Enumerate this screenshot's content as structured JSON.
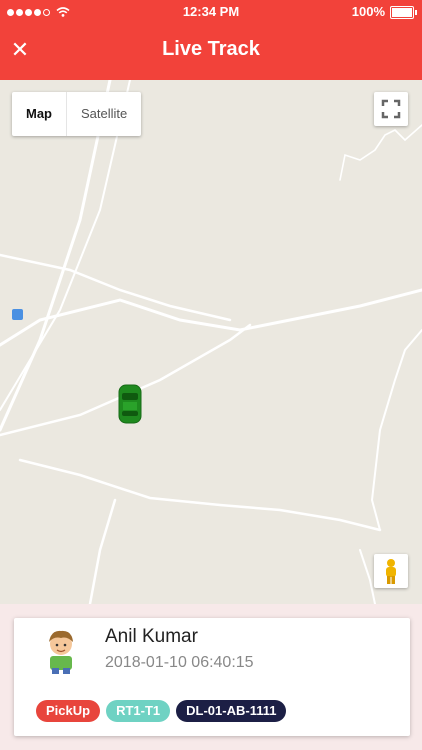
{
  "status_bar": {
    "time": "12:34 PM",
    "battery": "100%"
  },
  "header": {
    "close_icon": "close-icon",
    "title": "Live Track"
  },
  "map": {
    "type_options": [
      "Map",
      "Satellite"
    ],
    "selected_type": "Map",
    "icons": [
      "fullscreen-icon",
      "pegman-icon",
      "car-icon",
      "transit-icon"
    ]
  },
  "tracking_card": {
    "name": "Anil Kumar",
    "timestamp": "2018-01-10 06:40:15",
    "badges": [
      {
        "label": "PickUp",
        "color": "#e8453c"
      },
      {
        "label": "RT1-T1",
        "color": "#6fd2c3"
      },
      {
        "label": "DL-01-AB-1111",
        "color": "#1c1f45"
      }
    ]
  },
  "colors": {
    "accent": "#f2423a",
    "panel_bg": "#f7e9e9",
    "map_bg": "#ebe8e0",
    "car": "#1f8a1f"
  }
}
